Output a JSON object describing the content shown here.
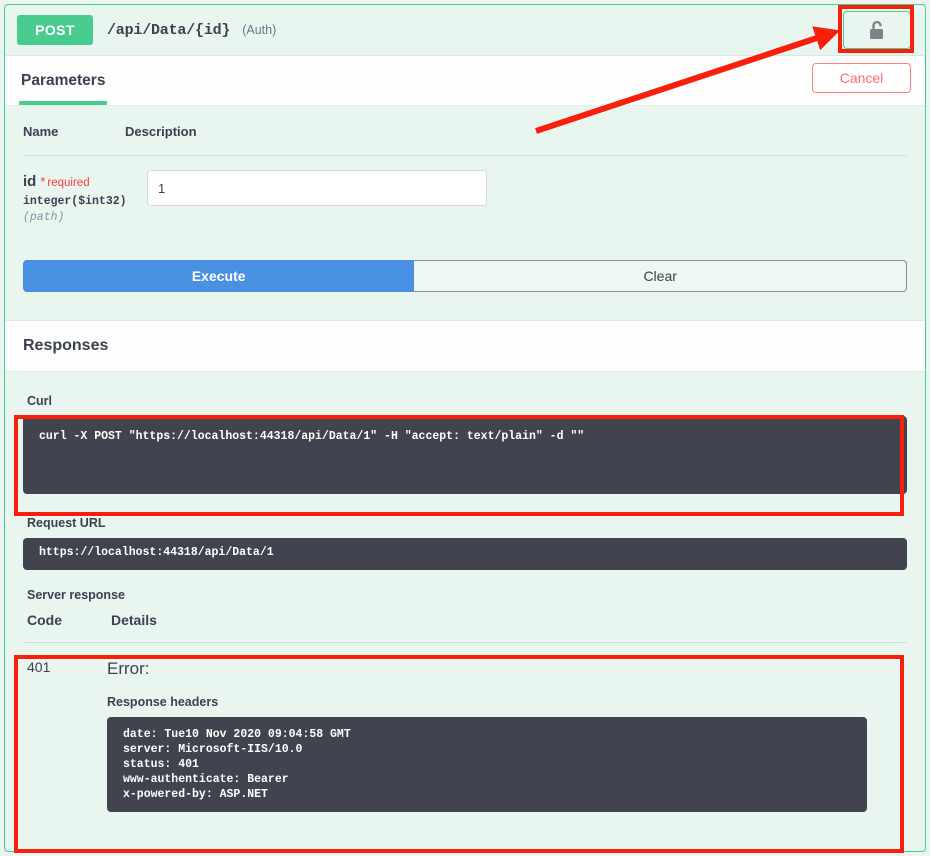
{
  "operation": {
    "method": "POST",
    "path": "/api/Data/{id}",
    "auth_note": "(Auth)",
    "auth_button_icon": "unlocked-padlock-icon"
  },
  "tabs": [
    {
      "label": "Parameters",
      "active": true
    }
  ],
  "cancel_label": "Cancel",
  "parameters": {
    "headers": {
      "name": "Name",
      "description": "Description"
    },
    "rows": [
      {
        "name": "id",
        "required_star": "*",
        "required_label": "required",
        "type": "integer($int32)",
        "in": "(path)",
        "value": "1",
        "placeholder": "id"
      }
    ]
  },
  "actions": {
    "execute_label": "Execute",
    "clear_label": "Clear"
  },
  "responses": {
    "section_title": "Responses",
    "curl_label": "Curl",
    "curl_command": "curl -X POST \"https://localhost:44318/api/Data/1\" -H \"accept: text/plain\" -d \"\"",
    "request_url_label": "Request URL",
    "request_url": "https://localhost:44318/api/Data/1",
    "server_response_label": "Server response",
    "table_headers": {
      "code": "Code",
      "details": "Details"
    },
    "rows": [
      {
        "code": "401",
        "error_label": "Error:",
        "response_headers_label": "Response headers",
        "response_headers": "date: Tue10 Nov 2020 09:04:58 GMT\nserver: Microsoft-IIS/10.0\nstatus: 401\nwww-authenticate: Bearer\nx-powered-by: ASP.NET"
      }
    ]
  },
  "annotations": {
    "rect_color": "#f81f0c",
    "arrow_color": "#f81f0c",
    "targets": [
      "auth-lock-button",
      "curl-block",
      "server-response-table"
    ]
  },
  "colors": {
    "page_background": "#e8f6ef",
    "method_post": "#49cc90",
    "execute_blue": "#4990e2",
    "code_block": "#41444e",
    "required_red": "#f93e3e",
    "cancel_red": "#fa6e6e"
  }
}
